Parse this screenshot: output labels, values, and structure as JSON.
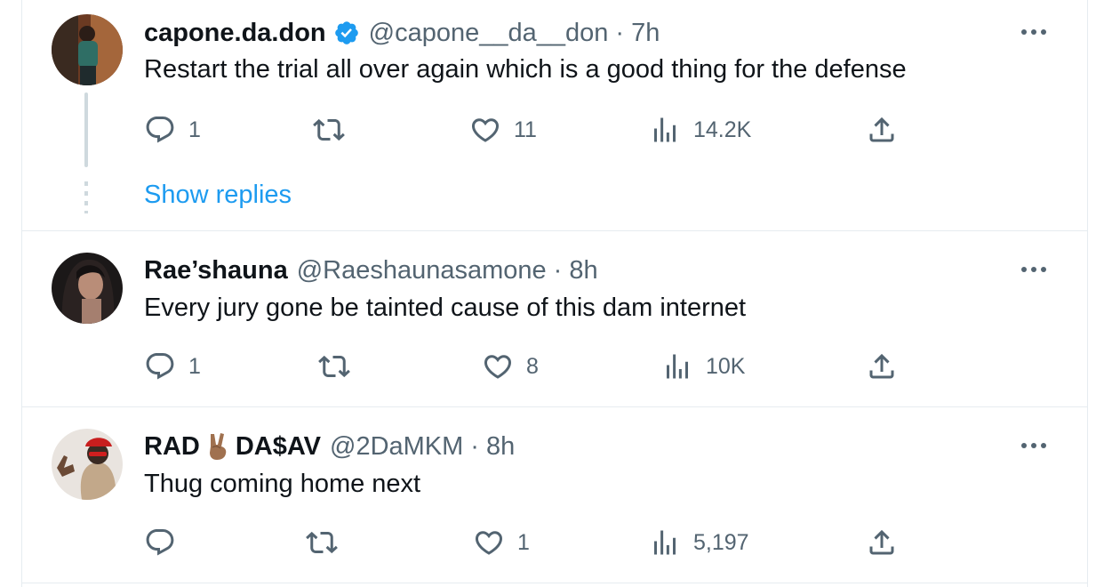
{
  "tweets": [
    {
      "name": "capone.da.don",
      "verified": true,
      "handle": "@capone__da__don",
      "separator": "·",
      "time": "7h",
      "text": "Restart the trial all over again which is a good thing for the defense",
      "replies": "1",
      "retweets": "",
      "likes": "11",
      "views": "14.2K",
      "show_replies": "Show replies"
    },
    {
      "name": "Rae’shauna",
      "handle": "@Raeshaunasamone",
      "separator": "·",
      "time": "8h",
      "text": "Every jury gone be tainted cause of this dam internet",
      "replies": "1",
      "retweets": "",
      "likes": "8",
      "views": "10K"
    },
    {
      "name_part1": "RAD",
      "name_emoji": "victory-hand-emoji",
      "name_part2": "DA$AV",
      "handle": "@2DaMKM",
      "separator": "·",
      "time": "8h",
      "text": "Thug coming home next",
      "replies": "",
      "retweets": "",
      "likes": "1",
      "views": "5,197"
    }
  ],
  "colors": {
    "text": "#0f1419",
    "secondary": "#536471",
    "link": "#1d9bf0",
    "verified": "#1d9bf0",
    "border": "#e6ecf0"
  },
  "icons": [
    "reply-icon",
    "retweet-icon",
    "like-icon",
    "views-icon",
    "share-icon",
    "more-icon",
    "verified-badge-icon"
  ]
}
